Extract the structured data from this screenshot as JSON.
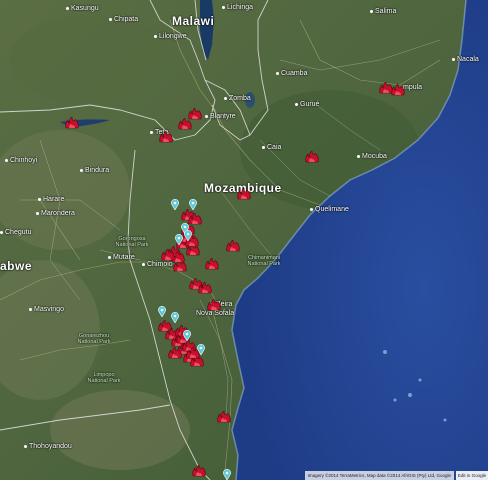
{
  "map": {
    "colors": {
      "land": "#4f6640",
      "land_light": "#6f7f53",
      "ocean": "#2b4e9a",
      "ocean_deep": "#1f3d86",
      "lake": "#163a6b",
      "fire": "#c8102e",
      "pin": "#5ec8d8",
      "border": "#e8e8e8"
    },
    "labels": {
      "malawi": "Malawi",
      "mozambique": "Mozambique",
      "zimbabwe": "abwe",
      "lilongwe": "Lilongwe",
      "zomba": "Zomba",
      "blantyre": "Blantyre",
      "tete": "Tete",
      "chipata": "Chipata",
      "nacala": "Nacala",
      "nampula": "mpula",
      "cuamba": "Cuamba",
      "gurue": "Gurué",
      "quelimane": "Quelimane",
      "mutare": "Mutare",
      "chimoio": "Chimoio",
      "beira": "Beira",
      "nova_sofala": "Nova Sofala",
      "masvingo": "Masvingo",
      "harare": "Harare",
      "kadoma": "Kadoma",
      "chinhoyi": "Chinhoyi",
      "bindura": "Bindura",
      "chegutu": "Chegutu",
      "marondera": "Marondera",
      "gweru": "Gweru",
      "thohoyandou": "Thohoyandou",
      "zimbabwe_park": "Gonarezhou National Park",
      "gorongosa_park": "Gorongosa National Park",
      "chimanimani_park": "Chimanimani National Park",
      "limpopo_park": "Limpopo National Park",
      "salima": "Salima",
      "balaka": "Balaka",
      "mangochi": "Mangochi",
      "lichinga": "Lichinga",
      "marrupa": "Marrupa",
      "caia": "Caia",
      "mocuba": "Mocuba",
      "ilha": "Ilha",
      "vilanculos": "Vilanculos",
      "kasungu": "Kasungu"
    },
    "fires": [
      "fire-1",
      "fire-2",
      "fire-3",
      "fire-4",
      "fire-5",
      "fire-6",
      "fire-7",
      "fire-8",
      "fire-9",
      "fire-10",
      "fire-11",
      "fire-12",
      "fire-13",
      "fire-14",
      "fire-15",
      "fire-16",
      "fire-17",
      "fire-18",
      "fire-19",
      "fire-20",
      "fire-21",
      "fire-22",
      "fire-23",
      "fire-24",
      "fire-25",
      "fire-26",
      "fire-27",
      "fire-28",
      "fire-29",
      "fire-30",
      "fire-31",
      "fire-32",
      "fire-33",
      "fire-34",
      "fire-35",
      "fire-36",
      "fire-37",
      "fire-38"
    ],
    "pins": [
      "pin-1",
      "pin-2",
      "pin-3",
      "pin-4",
      "pin-5",
      "pin-6",
      "pin-7",
      "pin-8",
      "pin-9",
      "pin-10"
    ],
    "attribution": "Imagery ©2014 TerraMetrics, Map data ©2014 AfriGIS (Pty) Ltd, Google",
    "attribution_link": "Edit in Google"
  }
}
